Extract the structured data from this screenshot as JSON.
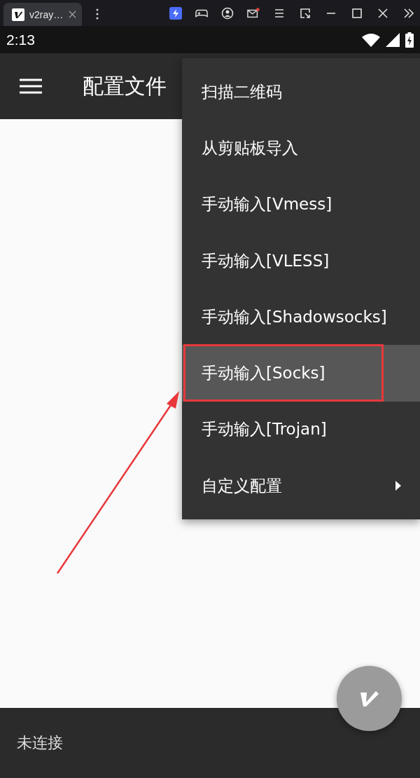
{
  "browser_tab": {
    "title": "v2ray…"
  },
  "status_bar": {
    "time": "2:13"
  },
  "app_bar": {
    "title": "配置文件"
  },
  "menu": {
    "items": [
      {
        "label": "扫描二维码",
        "kind": "plain",
        "selected": false
      },
      {
        "label": "从剪贴板导入",
        "kind": "plain",
        "selected": false
      },
      {
        "label": "手动输入[Vmess]",
        "kind": "plain",
        "selected": false
      },
      {
        "label": "手动输入[VLESS]",
        "kind": "plain",
        "selected": false
      },
      {
        "label": "手动输入[Shadowsocks]",
        "kind": "plain",
        "selected": false
      },
      {
        "label": "手动输入[Socks]",
        "kind": "plain",
        "selected": true
      },
      {
        "label": "手动输入[Trojan]",
        "kind": "plain",
        "selected": false
      },
      {
        "label": "自定义配置",
        "kind": "submenu",
        "selected": false
      }
    ]
  },
  "bottom_bar": {
    "status": "未连接"
  }
}
